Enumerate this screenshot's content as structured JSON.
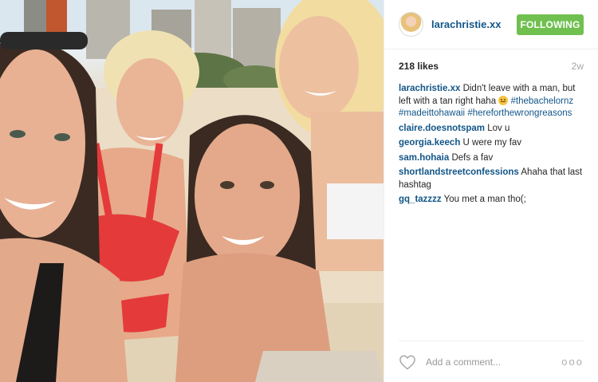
{
  "post": {
    "author": "larachristie.xx",
    "follow_label": "FOLLOWING",
    "likes": "218 likes",
    "time_ago": "2w",
    "caption": {
      "user": "larachristie.xx",
      "text": "Didn't leave with a man, but left with a tan right haha",
      "emoji": "upside-down-face-emoji",
      "hashtags": [
        "#thebachelornz",
        "#madeittohawaii",
        "#hereforthewrongreasons"
      ]
    },
    "comments": [
      {
        "user": "claire.doesnotspam",
        "text": "Lov u"
      },
      {
        "user": "georgia.keech",
        "text": "U were my fav"
      },
      {
        "user": "sam.hohaia",
        "text": "Defs a fav"
      },
      {
        "user": "shortlandstreetconfessions",
        "text": "Ahaha that last hashtag"
      },
      {
        "user": "gq_tazzzz",
        "text": "You met a man tho(;"
      }
    ],
    "add_comment_placeholder": "Add a comment...",
    "more_label": "ooo"
  },
  "icons": {
    "like": "heart-outline-icon",
    "more": "more-options-icon"
  },
  "colors": {
    "link": "#125688",
    "follow_button": "#70c050",
    "muted": "#a5a7aa"
  }
}
